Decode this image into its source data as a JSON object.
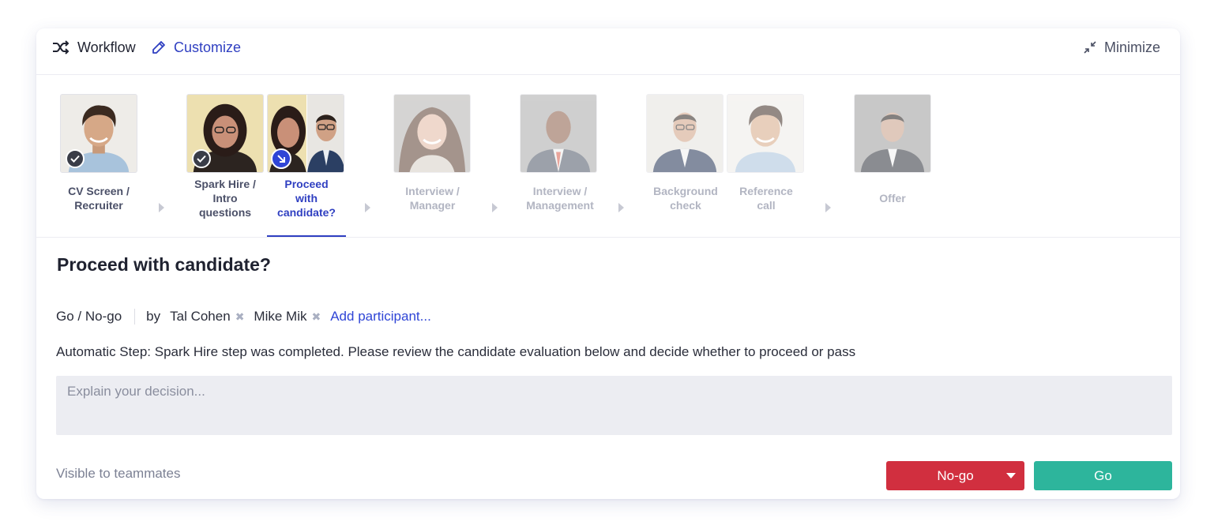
{
  "topbar": {
    "workflow_label": "Workflow",
    "customize_label": "Customize",
    "minimize_label": "Minimize"
  },
  "steps": [
    {
      "label_lines": [
        "CV Screen /",
        "Recruiter"
      ],
      "status": "completed"
    },
    {
      "label_lines": [
        "Spark Hire /",
        "Intro",
        "questions"
      ],
      "status": "completed"
    },
    {
      "label_lines": [
        "Proceed",
        "with",
        "candidate?"
      ],
      "status": "current"
    },
    {
      "label_lines": [
        "Interview /",
        "Manager"
      ],
      "status": "pending"
    },
    {
      "label_lines": [
        "Interview /",
        "Management"
      ],
      "status": "pending"
    },
    {
      "label_lines": [
        "Background",
        "check"
      ],
      "status": "pending"
    },
    {
      "label_lines": [
        "Reference",
        "call"
      ],
      "status": "pending"
    },
    {
      "label_lines": [
        "Offer"
      ],
      "status": "pending"
    }
  ],
  "main": {
    "title": "Proceed with candidate?",
    "decision_type": "Go / No-go",
    "by_label": "by",
    "participants": [
      "Tal Cohen",
      "Mike Mik"
    ],
    "add_participant_label": "Add participant...",
    "automatic_text": "Automatic Step: Spark Hire step was completed. Please review the candidate evaluation below and decide whether to proceed or pass",
    "decision_placeholder": "Explain your decision...",
    "visibility_label": "Visible to teammates",
    "nogo_label": "No-go",
    "go_label": "Go"
  },
  "colors": {
    "accent": "#2f3fc1",
    "nogo": "#d12f3f",
    "go": "#2db59c"
  },
  "icons": {
    "workflow": "shuffle-icon",
    "customize": "pencil-icon",
    "minimize": "minimize-icon",
    "completed": "check-icon",
    "current": "arrow-down-right-icon"
  }
}
